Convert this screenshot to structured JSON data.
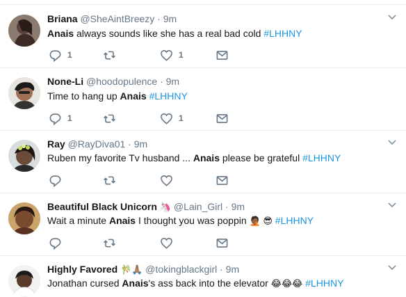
{
  "tweets": [
    {
      "name": "Briana",
      "emoji": "",
      "handle": "@SheAintBreezy",
      "time": "9m",
      "pre": "",
      "bold": "Anais",
      "post": " always sounds like she has a real bad cold ",
      "tail_emoji": "",
      "tag": "#LHHNY",
      "replies": "1",
      "retweets": "",
      "likes": "1"
    },
    {
      "name": "None-Li",
      "emoji": "",
      "handle": "@hoodopulence",
      "time": "9m",
      "pre": "Time to hang up ",
      "bold": "Anais",
      "post": " ",
      "tail_emoji": "",
      "tag": "#LHHNY",
      "replies": "1",
      "retweets": "",
      "likes": "1"
    },
    {
      "name": "Ray",
      "emoji": "",
      "handle": "@RayDiva01",
      "time": "9m",
      "pre": "Ruben my favorite Tv husband ... ",
      "bold": "Anais",
      "post": " please be grateful ",
      "tail_emoji": "",
      "tag": "#LHHNY",
      "replies": "",
      "retweets": "",
      "likes": ""
    },
    {
      "name": "Beautiful Black Unicorn",
      "emoji": "🦄",
      "handle": "@Lain_Girl",
      "time": "9m",
      "pre": "Wait a minute ",
      "bold": "Anais",
      "post": " I thought you was poppin ",
      "tail_emoji": "🤦🏾 😎",
      "tag": "#LHHNY",
      "replies": "",
      "retweets": "",
      "likes": ""
    },
    {
      "name": "Highly Favored",
      "emoji": "🎋🙏🏽",
      "handle": "@tokingblackgirl",
      "time": "9m",
      "pre": "Jonathan cursed ",
      "bold": "Anais",
      "post": "'s ass back into the elevator ",
      "tail_emoji": "😂😂😂",
      "tag": "#LHHNY",
      "replies": "",
      "retweets": "",
      "likes": ""
    }
  ],
  "separator": "·",
  "icons": [
    "reply-icon",
    "retweet-icon",
    "like-icon",
    "message-icon",
    "caret-down-icon"
  ],
  "colors": {
    "text": "#14171a",
    "muted": "#657786",
    "link": "#1b95e0",
    "border": "#e6ecf0"
  }
}
